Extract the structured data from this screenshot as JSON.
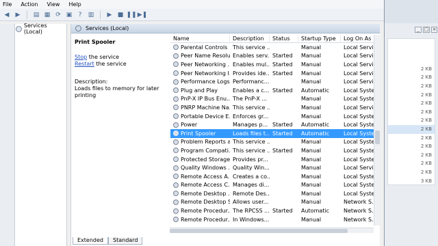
{
  "menu": [
    "File",
    "Action",
    "View",
    "Help"
  ],
  "tree": {
    "root_label": "Services (Local)"
  },
  "header": {
    "title": "Services (Local)"
  },
  "details": {
    "service_name": "Print Spooler",
    "stop_link": "Stop",
    "stop_text": " the service",
    "restart_link": "Restart",
    "restart_text": " the service",
    "description_label": "Description:",
    "description_text": "Loads files to memory for later printing"
  },
  "columns": [
    "Name",
    "Description",
    "Status",
    "Startup Type",
    "Log On As"
  ],
  "rows": [
    [
      "Parental Controls",
      "This service ...",
      "",
      "Manual",
      "Local Service"
    ],
    [
      "Peer Name Resolu...",
      "Enables serv...",
      "Started",
      "Manual",
      "Local Service"
    ],
    [
      "Peer Networking ...",
      "Enables mul...",
      "Started",
      "Manual",
      "Local Service"
    ],
    [
      "Peer Networking I...",
      "Provides ide...",
      "Started",
      "Manual",
      "Local Service"
    ],
    [
      "Performance Logs...",
      "Performanc...",
      "",
      "Manual",
      "Local Service"
    ],
    [
      "Plug and Play",
      "Enables a c...",
      "Started",
      "Automatic",
      "Local Syste..."
    ],
    [
      "PnP-X IP Bus Enu...",
      "The PnP-X ...",
      "",
      "Manual",
      "Local Syste..."
    ],
    [
      "PNRP Machine Na...",
      "This service ...",
      "",
      "Manual",
      "Local Service"
    ],
    [
      "Portable Device E...",
      "Enforces gr...",
      "",
      "Manual",
      "Local Syste..."
    ],
    [
      "Power",
      "Manages p...",
      "Started",
      "Automatic",
      "Local Syste..."
    ],
    [
      "Print Spooler",
      "Loads files t...",
      "Started",
      "Automatic",
      "Local Syste..."
    ],
    [
      "Problem Reports a...",
      "This service ...",
      "",
      "Manual",
      "Local Syste..."
    ],
    [
      "Program Compati...",
      "This service ...",
      "Started",
      "Manual",
      "Local Syste..."
    ],
    [
      "Protected Storage",
      "Provides pr...",
      "",
      "Manual",
      "Local Syste..."
    ],
    [
      "Quality Windows ...",
      "Quality Win...",
      "",
      "Manual",
      "Local Service"
    ],
    [
      "Remote Access A...",
      "Creates a co...",
      "",
      "Manual",
      "Local Syste..."
    ],
    [
      "Remote Access C...",
      "Manages di...",
      "",
      "Manual",
      "Local Syste..."
    ],
    [
      "Remote Desktop ...",
      "Remote Des...",
      "",
      "Manual",
      "Local Syste..."
    ],
    [
      "Remote Desktop S...",
      "Allows user...",
      "",
      "Manual",
      "Network S..."
    ],
    [
      "Remote Procedur...",
      "The RPCSS ...",
      "Started",
      "Automatic",
      "Network S..."
    ],
    [
      "Remote Procedur...",
      "In Windows...",
      "",
      "Manual",
      "Network S..."
    ]
  ],
  "tabs": [
    "Extended",
    "Standard"
  ],
  "right_panel": {
    "sizes": [
      "",
      "",
      "",
      "2 KB",
      "2 KB",
      "2 KB",
      "2 KB",
      "2 KB",
      "2 KB",
      "2 KB",
      "2 KB",
      "2 KB",
      "2 KB",
      "2 KB",
      "2 KB",
      "2 KB",
      "3 KB"
    ]
  }
}
